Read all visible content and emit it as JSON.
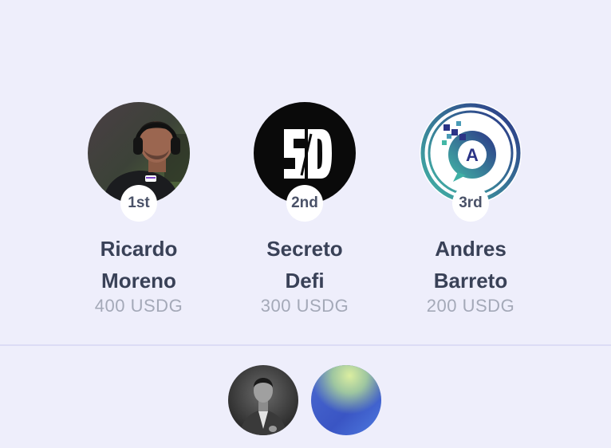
{
  "leaderboard": {
    "winners": [
      {
        "name_line1": "Ricardo",
        "name_line2": "Moreno",
        "amount": "400 USDG",
        "rank": "1st",
        "avatar": "photo-man-headphones"
      },
      {
        "name_line1": "Secreto",
        "name_line2": "Defi",
        "amount": "300 USDG",
        "rank": "2nd",
        "avatar": "sd-logo"
      },
      {
        "name_line1": "Andres",
        "name_line2": "Barreto",
        "amount": "200 USDG",
        "rank": "3rd",
        "avatar": "a-chat-logo"
      }
    ],
    "others": [
      {
        "avatar": "photo-man-suit-grayscale"
      },
      {
        "avatar": "gradient-blue-green"
      }
    ]
  },
  "colors": {
    "background": "#eeeefb",
    "name_text": "#394157",
    "amount_text": "#a4a9b8",
    "badge_bg": "#ffffff",
    "divider": "#dcdcf5",
    "logo_teal": "#3fb5a7",
    "logo_indigo": "#2e3a8c"
  }
}
